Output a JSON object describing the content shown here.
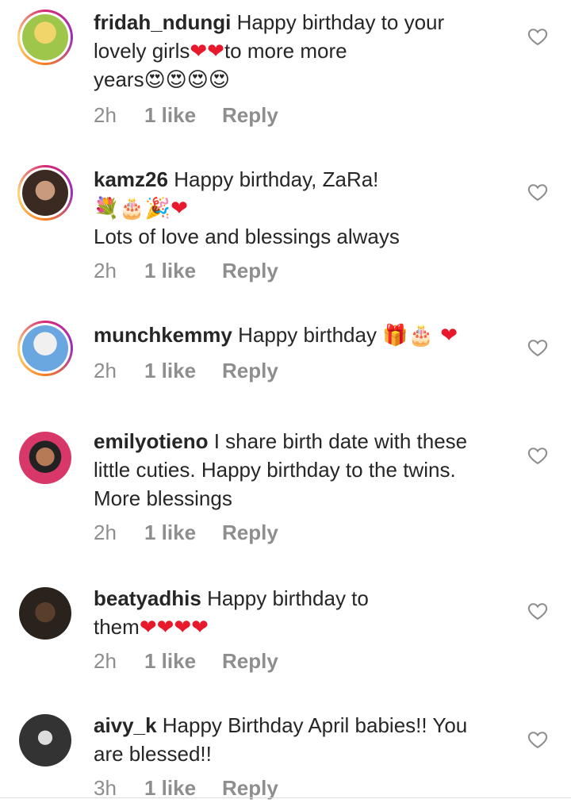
{
  "comments": [
    {
      "username": "fridah_ndungi",
      "lines": [
        "Happy birthday to your",
        "lovely girls",
        "to more more",
        "years"
      ],
      "emoji_hearts_1": "❤❤",
      "emoji_faces": "😍😍😍😍",
      "time": "2h",
      "likes": "1 like",
      "reply": "Reply",
      "avatar_story": true,
      "avatar_color": "#9ec64a"
    },
    {
      "username": "kamz26",
      "lines": [
        "Happy birthday, ZaRa!",
        "Lots of love and blessings always"
      ],
      "emoji_row": "💐🎂🎉❤",
      "time": "2h",
      "likes": "1 like",
      "reply": "Reply",
      "avatar_story": true,
      "avatar_color": "#6b4a3a"
    },
    {
      "username": "munchkemmy",
      "lines": [
        "Happy birthday"
      ],
      "emoji_row": "🎁🎂 ❤",
      "time": "2h",
      "likes": "1 like",
      "reply": "Reply",
      "avatar_story": true,
      "avatar_color": "#5b8fd0"
    },
    {
      "username": "emilyotieno",
      "lines": [
        "I share birth date with these",
        "little cuties. Happy birthday to the twins.",
        "More blessings"
      ],
      "time": "2h",
      "likes": "1 like",
      "reply": "Reply",
      "avatar_story": false,
      "avatar_color": "#d8376a"
    },
    {
      "username": "beatyadhis",
      "lines": [
        "Happy birthday to",
        "them"
      ],
      "emoji_row": "❤❤❤❤",
      "time": "2h",
      "likes": "1 like",
      "reply": "Reply",
      "avatar_story": false,
      "avatar_color": "#3d3128"
    },
    {
      "username": "aivy_k",
      "lines": [
        "Happy Birthday April babies!! You",
        "are blessed!!"
      ],
      "time": "3h",
      "likes": "1 like",
      "reply": "Reply",
      "avatar_story": false,
      "avatar_color": "#2a2a2a"
    }
  ],
  "icons": {
    "like": "heart-outline-icon"
  },
  "colors": {
    "meta_text": "#8e8e8e",
    "primary_text": "#262626",
    "heart_emoji": "#e8192c"
  }
}
